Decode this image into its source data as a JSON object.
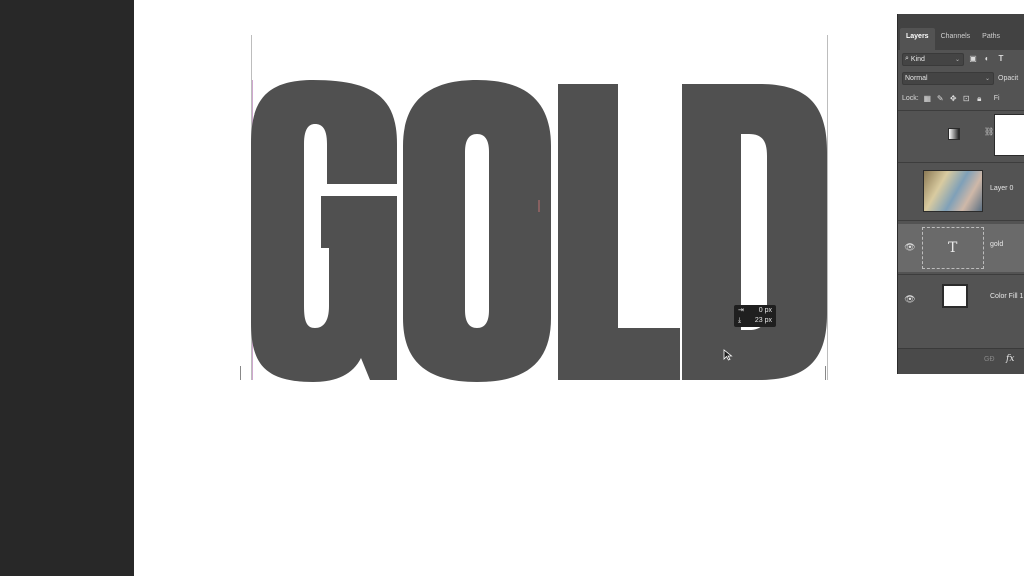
{
  "document": {
    "text_layer_content": "GOLD",
    "text_color": "#505050"
  },
  "measurement_tooltip": {
    "horizontal": "0 px",
    "vertical": "23 px"
  },
  "layers_panel": {
    "tabs": [
      {
        "label": "Layers",
        "active": true
      },
      {
        "label": "Channels",
        "active": false
      },
      {
        "label": "Paths",
        "active": false
      }
    ],
    "filter_kind": "Kind",
    "blend_mode": "Normal",
    "opacity_label": "Opacit",
    "lock_label": "Lock:",
    "fill_label": "Fi",
    "layers": [
      {
        "name": "",
        "type": "adjustment-gradient",
        "visible": false
      },
      {
        "name": "Layer 0",
        "type": "image",
        "visible": false
      },
      {
        "name": "gold",
        "type": "text",
        "visible": true,
        "selected": true
      },
      {
        "name": "Color Fill 1",
        "type": "fill",
        "visible": true
      }
    ],
    "bottom_link_label": "GĐ",
    "bottom_fx_label": "fx"
  },
  "colors": {
    "left_bar": "#282828",
    "panel_bg": "#535353",
    "panel_selected": "#6a6a6a"
  }
}
